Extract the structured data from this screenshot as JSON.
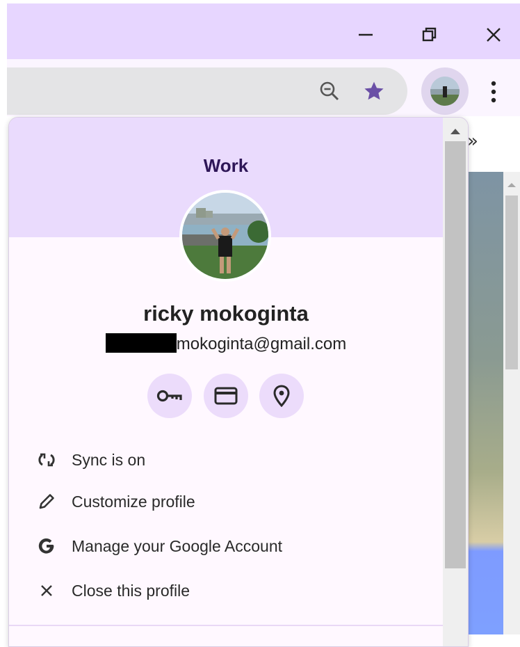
{
  "window": {
    "controls": [
      {
        "name": "minimize",
        "icon": "minimize-icon"
      },
      {
        "name": "restore",
        "icon": "restore-icon"
      },
      {
        "name": "close",
        "icon": "close-icon"
      }
    ]
  },
  "toolbar": {
    "zoom_icon": "zoom-out-icon",
    "bookmark_icon": "star-icon",
    "bookmark_color": "#6a4fa6",
    "more_icon": "more-vertical-icon",
    "overflow_chevrons": "»"
  },
  "profile_popup": {
    "profile_label": "Work",
    "user_name": "ricky mokoginta",
    "email_visible": "mokoginta@gmail.com",
    "quick_actions": [
      {
        "name": "passwords",
        "icon": "key-icon"
      },
      {
        "name": "payment-methods",
        "icon": "credit-card-icon"
      },
      {
        "name": "addresses",
        "icon": "location-pin-icon"
      }
    ],
    "menu": [
      {
        "icon": "sync-icon",
        "label": "Sync is on"
      },
      {
        "icon": "pencil-icon",
        "label": "Customize profile"
      },
      {
        "icon": "google-g-icon",
        "label": "Manage your Google Account"
      },
      {
        "icon": "close-icon",
        "label": "Close this profile"
      }
    ],
    "header_color": "#eadbfd",
    "accent_color": "#2e1657"
  }
}
